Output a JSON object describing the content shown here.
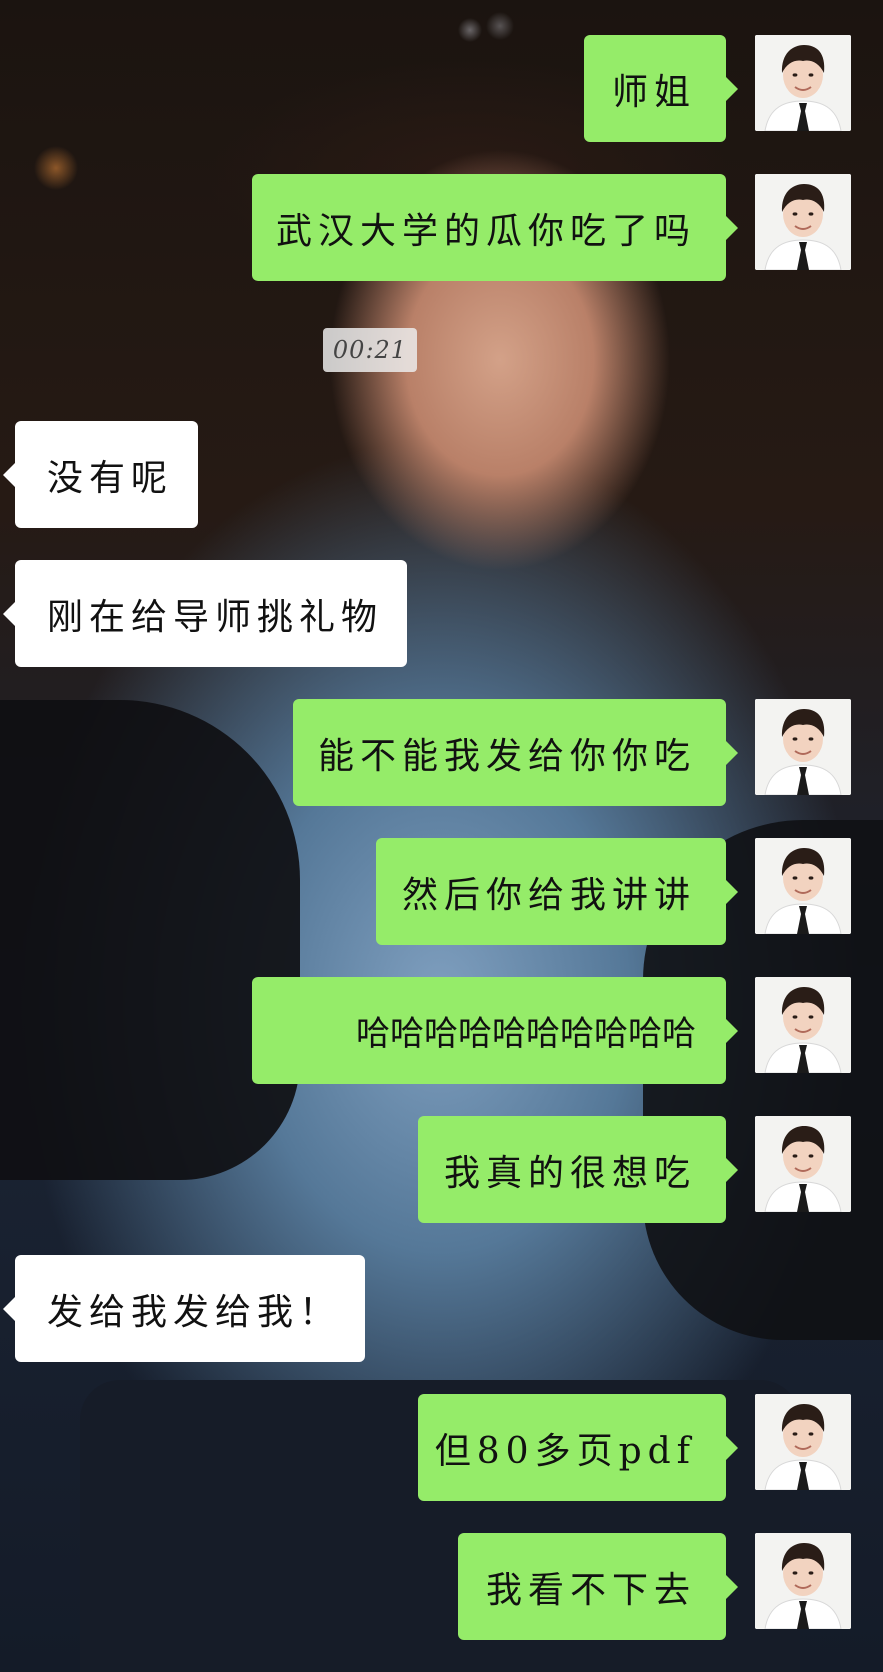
{
  "chat": {
    "timestamp": "00:21",
    "messages": [
      {
        "sender": "me",
        "text": "师姐"
      },
      {
        "sender": "me",
        "text": "武汉大学的瓜你吃了吗"
      },
      {
        "sender": "other",
        "text": "没有呢"
      },
      {
        "sender": "other",
        "text": "刚在给导师挑礼物"
      },
      {
        "sender": "me",
        "text": "能不能我发给你你吃"
      },
      {
        "sender": "me",
        "text": "然后你给我讲讲"
      },
      {
        "sender": "me",
        "text": "哈哈哈哈哈哈哈哈哈哈"
      },
      {
        "sender": "me",
        "text": "我真的很想吃"
      },
      {
        "sender": "other",
        "text": "发给我发给我！"
      },
      {
        "sender": "me",
        "text": "但80多页pdf"
      },
      {
        "sender": "me",
        "text": "我看不下去"
      }
    ]
  },
  "colors": {
    "my_bubble": "#95ec69",
    "other_bubble": "#ffffff"
  }
}
